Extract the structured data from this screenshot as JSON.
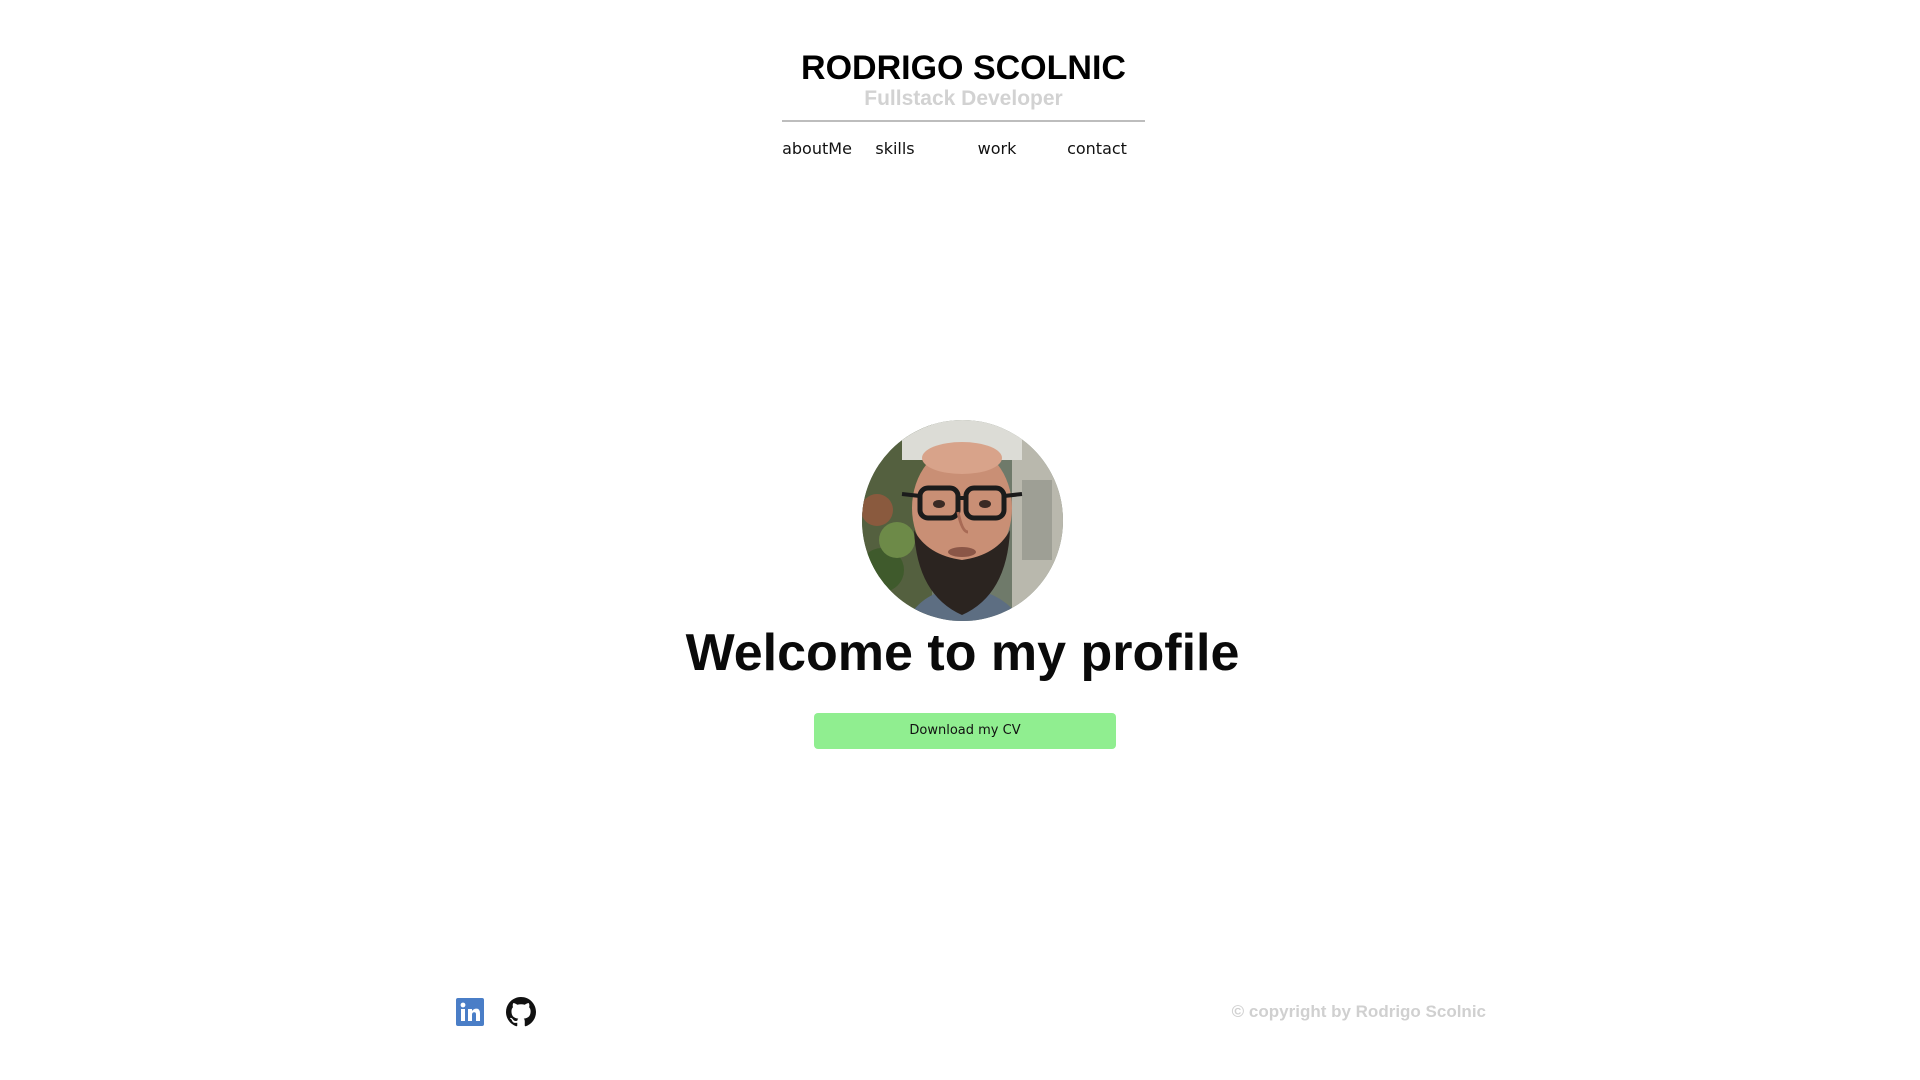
{
  "header": {
    "title": "RODRIGO SCOLNIC",
    "subtitle": "Fullstack Developer"
  },
  "nav": {
    "items": [
      {
        "label": "aboutMe"
      },
      {
        "label": "skills"
      },
      {
        "label": "work"
      },
      {
        "label": "contact"
      }
    ]
  },
  "hero": {
    "avatar_icon": "profile-photo",
    "heading": "Welcome to my profile",
    "cv_button_label": "Download my CV"
  },
  "footer": {
    "social": [
      {
        "icon": "linkedin-icon",
        "color": "#0a66c2"
      },
      {
        "icon": "github-icon",
        "color": "#111111"
      }
    ],
    "copyright": "© copyright by Rodrigo Scolnic"
  },
  "colors": {
    "accent_button": "#90ee90",
    "subtitle_gray": "#d2d2d2",
    "copyright_gray": "#d0d0d0"
  }
}
